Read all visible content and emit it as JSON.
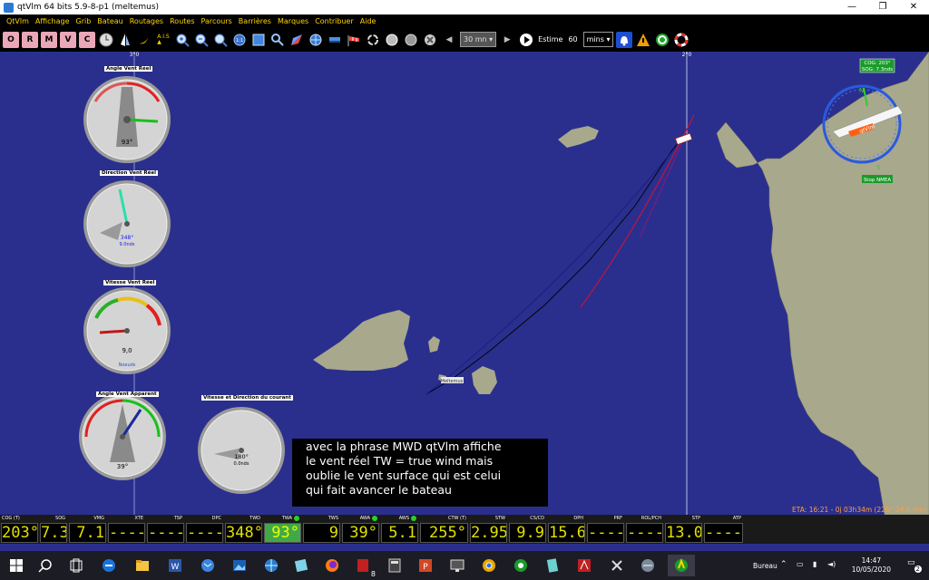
{
  "window": {
    "title": "qtVlm 64 bits 5.9-8-p1 (meltemus)",
    "minimize": "—",
    "restore": "❐",
    "close": "✕"
  },
  "menu": [
    "QtVlm",
    "Affichage",
    "Grib",
    "Bateau",
    "Routages",
    "Routes",
    "Parcours",
    "Barrières",
    "Marques",
    "Contribuer",
    "Aide"
  ],
  "toolbar": {
    "period": "30 mn",
    "estime_label": "Estime",
    "estime_value": "60",
    "estime_unit": "mins",
    "letters": [
      "O",
      "R",
      "M",
      "V",
      "C"
    ]
  },
  "map": {
    "longitude_labels": [
      "3°0",
      "2°0"
    ],
    "compass": {
      "cog_sog": [
        "COG: 203°",
        "SOG: 7.3nds"
      ],
      "boat_label": "qtVlm",
      "north": "N",
      "south": "S",
      "nmea": "Stop NMEA"
    },
    "boat_marker": "Meltemus"
  },
  "gauges": [
    {
      "title": "Angle Vent Réel",
      "readout": "93°",
      "unit": ""
    },
    {
      "title": "Direction Vent Réel",
      "readout": "348°",
      "readout2": "9.0nds"
    },
    {
      "title": "Vitesse Vent Réel",
      "readout": "9,0",
      "unit": "Noeuds"
    },
    {
      "title": "Angle Vent Apparent",
      "readout": "39°"
    },
    {
      "title": "Vitesse et Direction du courant",
      "readout": "180°",
      "readout2": "0.0nds"
    }
  ],
  "note": {
    "lines": [
      "avec la phrase MWD qtVlm affiche",
      "le vent réel TW = true wind mais",
      "oublie le vent surface qui est celui",
      "qui fait avancer le bateau"
    ]
  },
  "eta": "ETA: 16:21 - 0j 03h34m (226° 24.0 nm)",
  "instruments": [
    {
      "label": "COG (T)",
      "value": "203°"
    },
    {
      "label": "SOG",
      "value": "7.36"
    },
    {
      "label": "VMG",
      "value": "7.1"
    },
    {
      "label": "XTE",
      "value": "----"
    },
    {
      "label": "TSP",
      "value": "----"
    },
    {
      "label": "DPC",
      "value": "----"
    },
    {
      "label": "TWD",
      "value": "348°"
    },
    {
      "label": "TWA",
      "value": "93°"
    },
    {
      "label": "TWS",
      "value": "9"
    },
    {
      "label": "AWA",
      "value": "39°"
    },
    {
      "label": "AWS",
      "value": "5.1"
    },
    {
      "label": "CTW (T)",
      "value": "255°"
    },
    {
      "label": "STW",
      "value": "2.95"
    },
    {
      "label": "CS/CD",
      "value": "9.9"
    },
    {
      "label": "DPH",
      "value": "15.6"
    },
    {
      "label": "PRF",
      "value": "----"
    },
    {
      "label": "ROL/PCH",
      "value": "----"
    },
    {
      "label": "STP",
      "value": "13.0°"
    },
    {
      "label": "ATP",
      "value": "----"
    }
  ],
  "taskbar": {
    "bureau": "Bureau",
    "time": "14:47",
    "date": "10/05/2020",
    "notif_count": "2",
    "badge": "8"
  },
  "colors": {
    "sea": "#2a2f8e",
    "land": "#a8a88c",
    "instrument_text": "#e0e000",
    "active_cell": "#41a848"
  }
}
